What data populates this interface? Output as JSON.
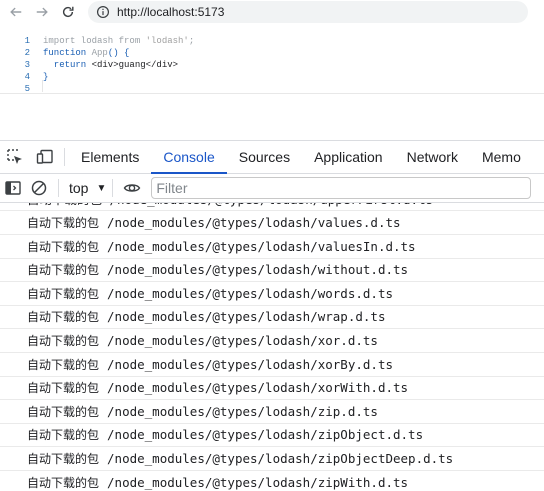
{
  "browser": {
    "url": "http://localhost:5173"
  },
  "editor": {
    "lines": [
      {
        "num": "1",
        "parts": [
          [
            "kw-grey",
            "import lodash from "
          ],
          [
            "str-grey",
            "'lodash'"
          ],
          [
            "kw-grey",
            ";"
          ]
        ]
      },
      {
        "num": "2",
        "parts": [
          [
            "kw-blue",
            "function "
          ],
          [
            "kw-grey",
            "App"
          ],
          [
            "kw-blue",
            "() {"
          ]
        ]
      },
      {
        "num": "3",
        "parts": [
          [
            "kw-blue",
            "  return "
          ],
          [
            "tag-dark",
            "<div>guang</div>"
          ]
        ]
      },
      {
        "num": "4",
        "parts": [
          [
            "kw-blue",
            "}"
          ]
        ]
      },
      {
        "num": "5",
        "parts": []
      }
    ]
  },
  "devtools": {
    "tabs": [
      {
        "label": "Elements",
        "active": false
      },
      {
        "label": "Console",
        "active": true
      },
      {
        "label": "Sources",
        "active": false
      },
      {
        "label": "Application",
        "active": false
      },
      {
        "label": "Network",
        "active": false
      },
      {
        "label": "Memo",
        "active": false
      }
    ],
    "context": "top",
    "filter_placeholder": "Filter"
  },
  "console": {
    "partial_row": "自动下载的包 /node_modules/@types/lodash/upperFirst.d.ts",
    "prefix": "自动下载的包",
    "rows": [
      "/node_modules/@types/lodash/values.d.ts",
      "/node_modules/@types/lodash/valuesIn.d.ts",
      "/node_modules/@types/lodash/without.d.ts",
      "/node_modules/@types/lodash/words.d.ts",
      "/node_modules/@types/lodash/wrap.d.ts",
      "/node_modules/@types/lodash/xor.d.ts",
      "/node_modules/@types/lodash/xorBy.d.ts",
      "/node_modules/@types/lodash/xorWith.d.ts",
      "/node_modules/@types/lodash/zip.d.ts",
      "/node_modules/@types/lodash/zipObject.d.ts",
      "/node_modules/@types/lodash/zipObjectDeep.d.ts",
      "/node_modules/@types/lodash/zipWith.d.ts"
    ]
  }
}
